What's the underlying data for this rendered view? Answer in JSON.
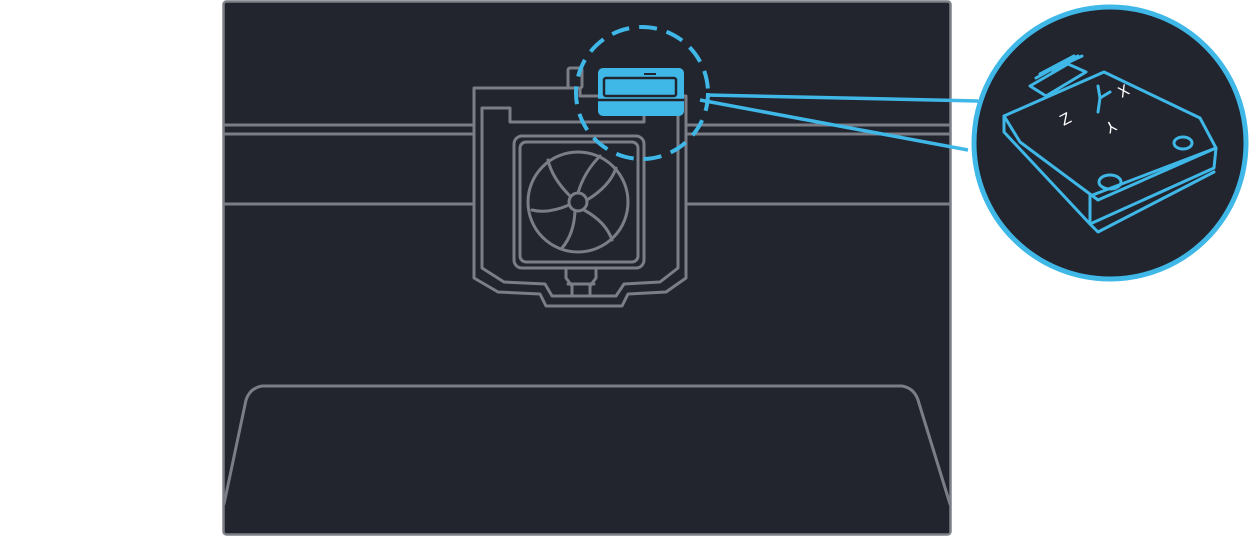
{
  "illustration": {
    "colors": {
      "panel_bg": "#22242e",
      "panel_border": "#7e8088",
      "line": "#7b7e86",
      "accent": "#3fb8e8",
      "white": "#ffffff"
    },
    "subject": {
      "printer_head": "print-head-with-fan",
      "highlighted_part": "accelerometer-sensor",
      "callout": "magnified-view"
    },
    "axis_labels": {
      "x": "X",
      "y": "Y",
      "z": "Z"
    }
  }
}
